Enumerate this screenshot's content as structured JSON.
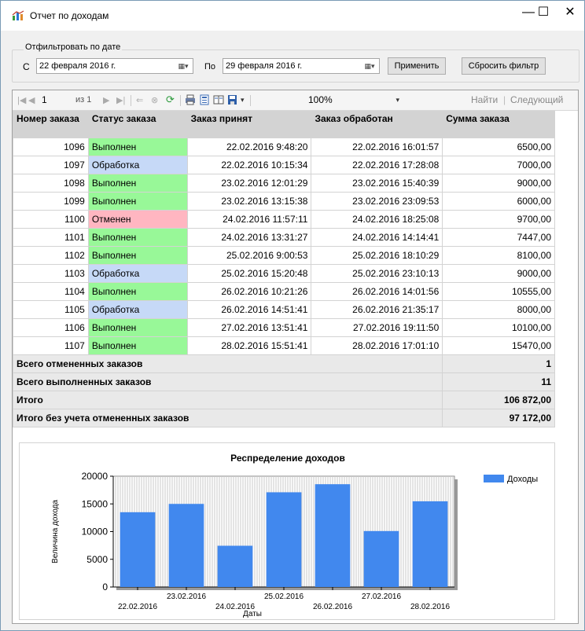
{
  "window": {
    "title": "Отчет по доходам",
    "minimize_glyph": "—",
    "maximize_glyph": "☐",
    "close_glyph": "✕"
  },
  "filter": {
    "legend": "Отфильтровать по дате",
    "from_label": "С",
    "to_label": "По",
    "from_value": "22 февраля  2016 г.",
    "to_value": "29 февраля  2016 г.",
    "dropdown_glyph": "▦▾",
    "apply_label": "Применить",
    "reset_label": "Сбросить фильтр"
  },
  "toolbar": {
    "first_glyph": "|◀",
    "prev_glyph": "◀",
    "page": "1",
    "of_text": "из 1",
    "next_glyph": "▶",
    "last_glyph": "▶|",
    "back_glyph": "⇐",
    "stop_glyph": "⊗",
    "refresh_glyph": "⟳",
    "zoom": "100%",
    "zoom_arrow": "▾",
    "find_label": "Найти",
    "separator": "|",
    "next_label": "Следующий"
  },
  "report": {
    "columns": [
      "Номер заказа",
      "Статус заказа",
      "Заказ принят",
      "Заказ обработан",
      "Сумма заказа"
    ],
    "rows": [
      {
        "id": "1096",
        "status": "Выполнен",
        "status_kind": "done",
        "accepted": "22.02.2016 9:48:20",
        "processed": "22.02.2016 16:01:57",
        "amount": "6500,00"
      },
      {
        "id": "1097",
        "status": "Обработка",
        "status_kind": "proc",
        "accepted": "22.02.2016 10:15:34",
        "processed": "22.02.2016 17:28:08",
        "amount": "7000,00"
      },
      {
        "id": "1098",
        "status": "Выполнен",
        "status_kind": "done",
        "accepted": "23.02.2016 12:01:29",
        "processed": "23.02.2016 15:40:39",
        "amount": "9000,00"
      },
      {
        "id": "1099",
        "status": "Выполнен",
        "status_kind": "done",
        "accepted": "23.02.2016 13:15:38",
        "processed": "23.02.2016 23:09:53",
        "amount": "6000,00"
      },
      {
        "id": "1100",
        "status": "Отменен",
        "status_kind": "cancel",
        "accepted": "24.02.2016 11:57:11",
        "processed": "24.02.2016 18:25:08",
        "amount": "9700,00"
      },
      {
        "id": "1101",
        "status": "Выполнен",
        "status_kind": "done",
        "accepted": "24.02.2016 13:31:27",
        "processed": "24.02.2016 14:14:41",
        "amount": "7447,00"
      },
      {
        "id": "1102",
        "status": "Выполнен",
        "status_kind": "done",
        "accepted": "25.02.2016 9:00:53",
        "processed": "25.02.2016 18:10:29",
        "amount": "8100,00"
      },
      {
        "id": "1103",
        "status": "Обработка",
        "status_kind": "proc",
        "accepted": "25.02.2016 15:20:48",
        "processed": "25.02.2016 23:10:13",
        "amount": "9000,00"
      },
      {
        "id": "1104",
        "status": "Выполнен",
        "status_kind": "done",
        "accepted": "26.02.2016 10:21:26",
        "processed": "26.02.2016 14:01:56",
        "amount": "10555,00"
      },
      {
        "id": "1105",
        "status": "Обработка",
        "status_kind": "proc",
        "accepted": "26.02.2016 14:51:41",
        "processed": "26.02.2016 21:35:17",
        "amount": "8000,00"
      },
      {
        "id": "1106",
        "status": "Выполнен",
        "status_kind": "done",
        "accepted": "27.02.2016 13:51:41",
        "processed": "27.02.2016 19:11:50",
        "amount": "10100,00"
      },
      {
        "id": "1107",
        "status": "Выполнен",
        "status_kind": "done",
        "accepted": "28.02.2016 15:51:41",
        "processed": "28.02.2016 17:01:10",
        "amount": "15470,00"
      }
    ],
    "summary": [
      {
        "label": "Всего отмененных заказов",
        "value": "1"
      },
      {
        "label": "Всего выполненных заказов",
        "value": "11"
      },
      {
        "label": "Итого",
        "value": "106 872,00"
      },
      {
        "label": "Итого без учета отмененных заказов",
        "value": "97 172,00"
      }
    ]
  },
  "colors": {
    "done": "#98f898",
    "proc": "#c6d9f7",
    "cancel": "#ffb6c1",
    "bar": "#4188ee"
  },
  "chart_data": {
    "type": "bar",
    "title": "Респределение доходов",
    "xlabel": "Даты",
    "ylabel": "Величина дохода",
    "ylim": [
      0,
      20000
    ],
    "yticks": [
      0,
      5000,
      10000,
      15000,
      20000
    ],
    "categories": [
      "22.02.2016",
      "23.02.2016",
      "24.02.2016",
      "25.02.2016",
      "26.02.2016",
      "27.02.2016",
      "28.02.2016"
    ],
    "series": [
      {
        "name": "Доходы",
        "values": [
          13500,
          15000,
          7447,
          17100,
          18555,
          10100,
          15470
        ]
      }
    ],
    "legend_position": "top-right",
    "grid": true
  }
}
